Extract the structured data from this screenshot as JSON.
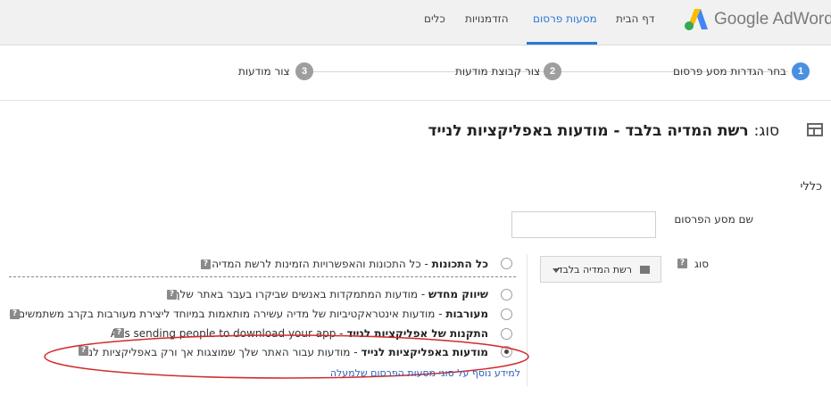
{
  "header": {
    "logo_text": "Google AdWords",
    "logo_colors": {
      "blue": "#4285f4",
      "yellow": "#fbbc05",
      "green": "#34a853"
    },
    "nav": [
      {
        "label": "דף הבית",
        "active": false
      },
      {
        "label": "מסעות פרסום",
        "active": true
      },
      {
        "label": "הזדמנויות",
        "active": false
      },
      {
        "label": "כלים",
        "active": false
      }
    ],
    "accent_color": "#2b78d6"
  },
  "steps": [
    {
      "number": "1",
      "label": "בחר הגדרות מסע פרסום",
      "active": true
    },
    {
      "number": "2",
      "label": "צור קבוצת מודעות",
      "active": false
    },
    {
      "number": "3",
      "label": "צור מודעות",
      "active": false
    }
  ],
  "type_heading": {
    "prefix": "סוג:",
    "title": "רשת המדיה בלבד - מודעות באפליקציות לנייד"
  },
  "section_general": "כללי",
  "campaign_name": {
    "label": "שם מסע הפרסום",
    "value": ""
  },
  "type_field": {
    "label": "סוג",
    "help": "?",
    "network_button": "רשת המדיה בלבד"
  },
  "options": [
    {
      "bold": "כל התכונות",
      "text": " - כל התכונות והאפשרויות הזמינות לרשת המדיה",
      "selected": false
    },
    {
      "bold": "שיווק מחדש",
      "text": " - מודעות המתמקדות באנשים שביקרו בעבר באתר שלך",
      "selected": false
    },
    {
      "bold": "מעורבות",
      "text": " - מודעות אינטראקטיביות של מדיה עשירה מותאמות במיוחד ליצירת מעורבות בקרב משתמשים",
      "selected": false
    },
    {
      "bold": "התקנות של אפליקציות לנייד",
      "text": " - Ads sending people to download your app",
      "selected": false
    },
    {
      "bold": "מודעות באפליקציות לנייד",
      "text": " - מודעות עבור האתר שלך שמוצגות אך ורק באפליקציות לנייד",
      "selected": true
    }
  ],
  "more_info_link": "למידע נוסף על סוגי מסעות הפרסום שלמעלה",
  "highlight_color": "#d22b2b"
}
